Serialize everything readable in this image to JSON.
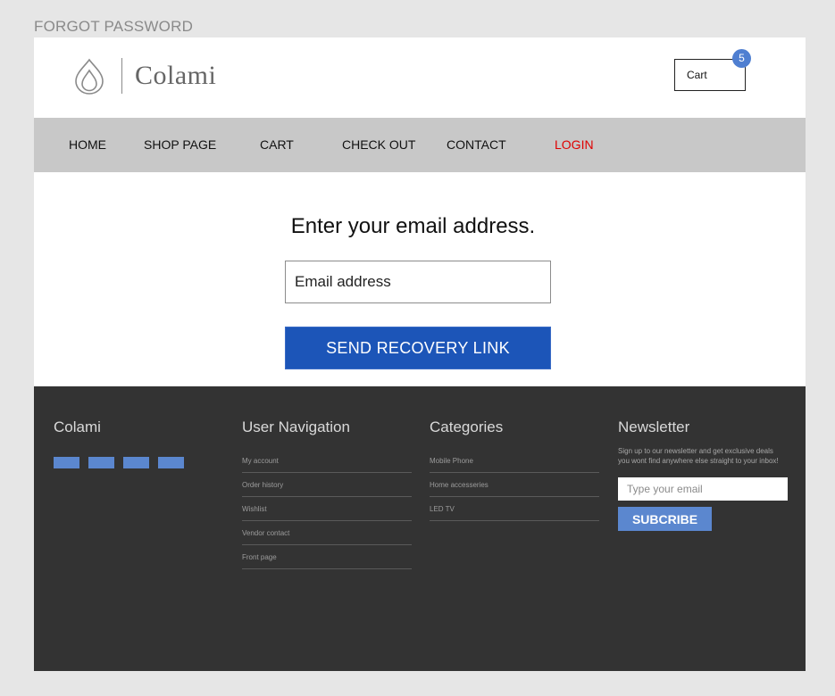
{
  "page_label": "FORGOT PASSWORD",
  "brand": {
    "name": "Colami"
  },
  "cart": {
    "label": "Cart",
    "count": "5"
  },
  "nav": {
    "items": [
      {
        "label": "HOME"
      },
      {
        "label": "SHOP PAGE"
      },
      {
        "label": "CART"
      },
      {
        "label": "CHECK OUT"
      },
      {
        "label": "CONTACT"
      },
      {
        "label": "LOGIN"
      }
    ],
    "active_color": "#e00000"
  },
  "main": {
    "title": "Enter your email address.",
    "email_placeholder": "Email address",
    "send_button": "SEND RECOVERY LINK"
  },
  "footer": {
    "brand": "Colami",
    "user_nav": {
      "title": "User Navigation",
      "links": [
        "My account",
        "Order history",
        "Wishlist",
        "Vendor contact",
        "Front page"
      ]
    },
    "categories": {
      "title": "Categories",
      "links": [
        "Mobile Phone",
        "Home accesseries",
        "LED TV"
      ]
    },
    "newsletter": {
      "title": "Newsletter",
      "text": "Sign up to our newsletter and get exclusive deals you wont find anywhere else straight to your inbox!",
      "placeholder": "Type your email",
      "button": "SUBCRIBE"
    }
  },
  "colors": {
    "primary_button": "#1c55b8",
    "accent": "#5b87cf",
    "nav_bg": "#c8c8c8",
    "footer_bg": "#333333"
  }
}
